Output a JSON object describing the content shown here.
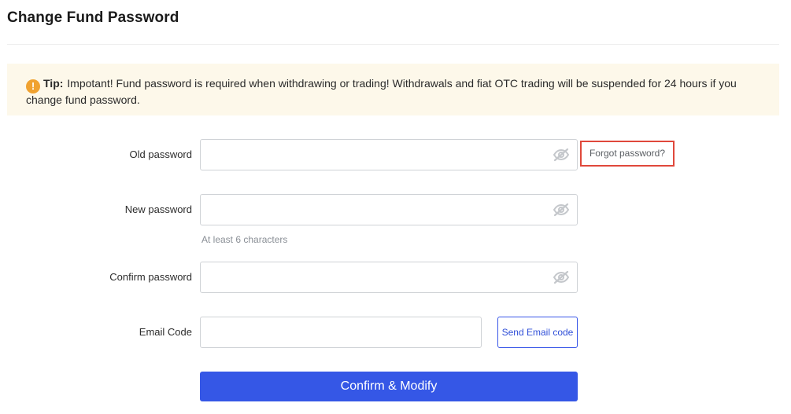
{
  "page": {
    "title": "Change Fund Password"
  },
  "tip": {
    "icon": "exclamation-icon",
    "icon_glyph": "!",
    "label": "Tip:",
    "text": "Impotant! Fund password is required when withdrawing or trading! Withdrawals and fiat OTC trading will be suspended for 24 hours if you change fund password.",
    "icon_color": "#f0a230",
    "background_color": "#fdf8ea"
  },
  "form": {
    "old_password": {
      "label": "Old password",
      "value": "",
      "placeholder": "",
      "icon": "eye-hidden-icon"
    },
    "forgot_link": "Forgot password?",
    "new_password": {
      "label": "New password",
      "value": "",
      "placeholder": "",
      "hint": "At least 6 characters",
      "icon": "eye-hidden-icon"
    },
    "confirm_password": {
      "label": "Confirm password",
      "value": "",
      "placeholder": "",
      "icon": "eye-hidden-icon"
    },
    "email_code": {
      "label": "Email Code",
      "value": "",
      "placeholder": ""
    },
    "send_code_label": "Send Email code",
    "submit_label": "Confirm & Modify"
  },
  "colors": {
    "primary": "#3557e6",
    "highlight_border": "#e0483b"
  }
}
